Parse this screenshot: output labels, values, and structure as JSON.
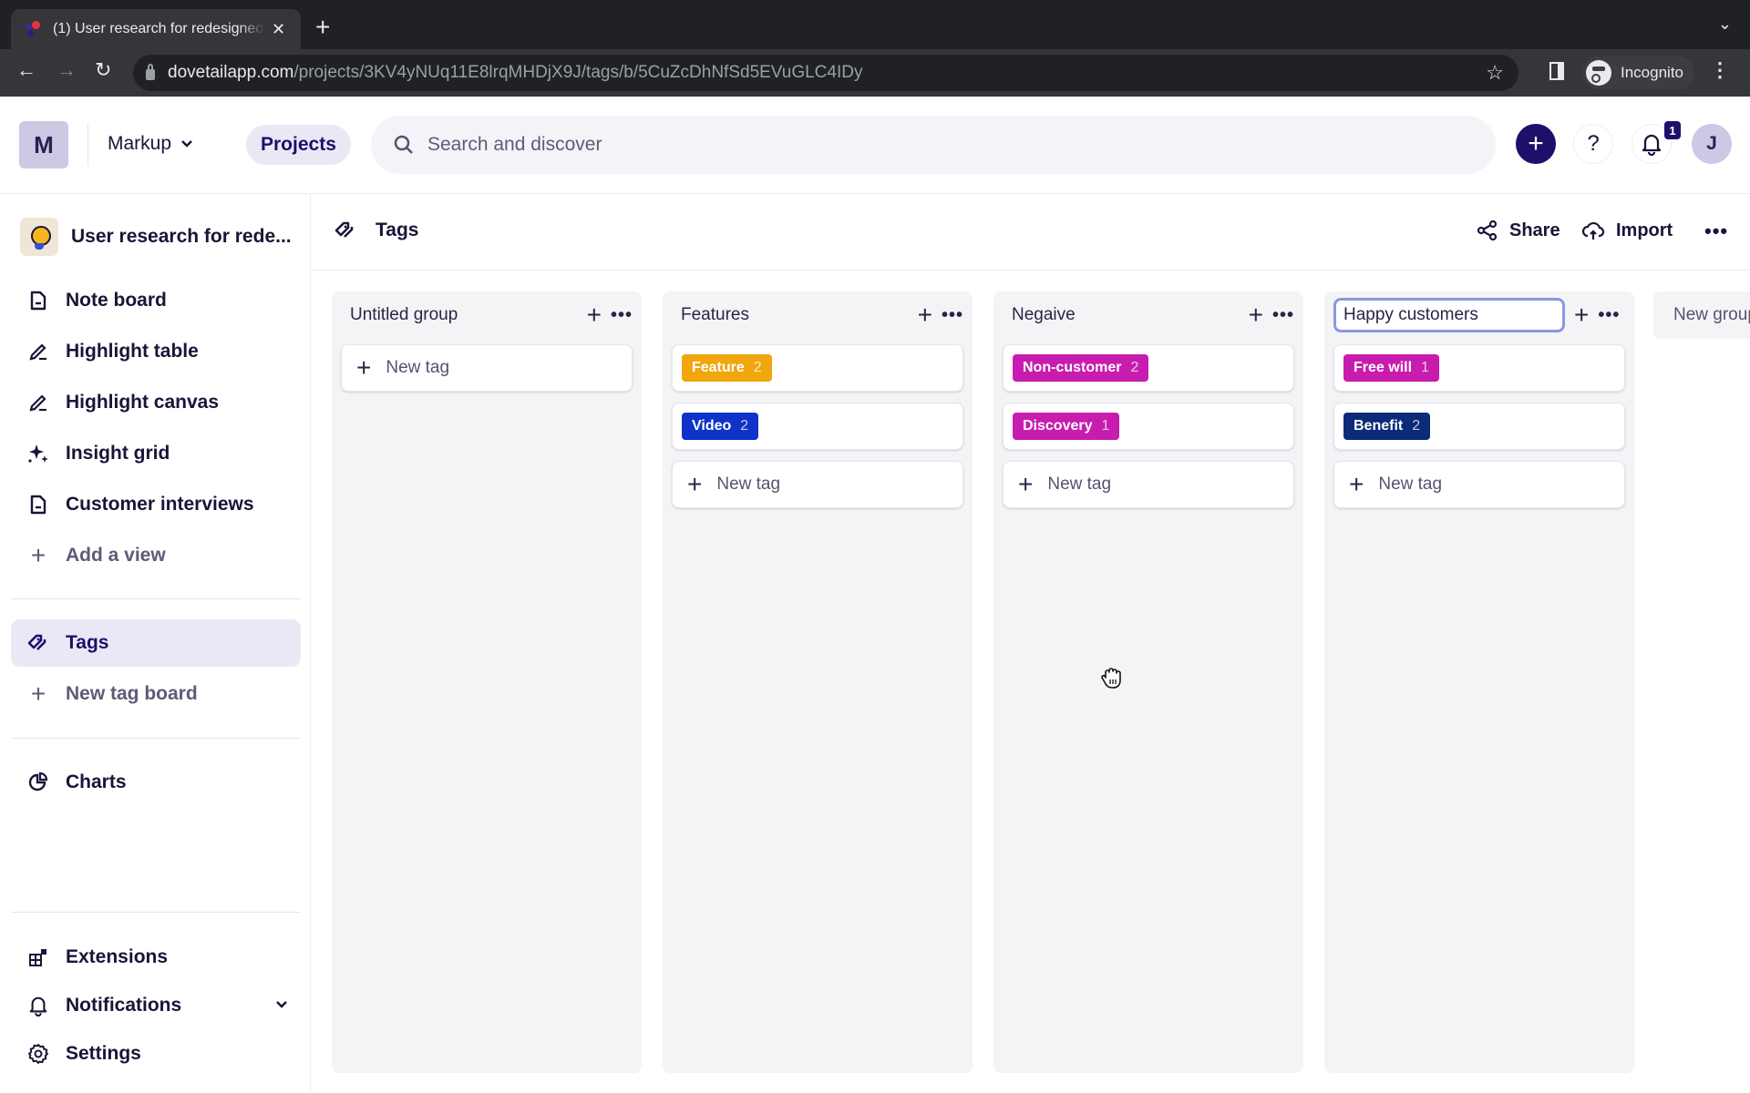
{
  "browser": {
    "tab_title": "(1) User research for redesigned",
    "new_tab": "+",
    "url_host": "dovetailapp.com",
    "url_path": "/projects/3KV4yNUq11E8lrqMHDjX9J/tags/b/5CuZcDhNfSd5EVuGLC4IDy",
    "incognito_label": "Incognito"
  },
  "header": {
    "workspace_initial": "M",
    "workspace_name": "Markup",
    "projects_label": "Projects",
    "search_placeholder": "Search and discover",
    "notification_count": "1",
    "avatar_initial": "J",
    "accent_color": "#1e0f6b"
  },
  "sidebar": {
    "project_name": "User research for rede...",
    "views": [
      {
        "label": "Note board",
        "icon": "note-icon"
      },
      {
        "label": "Highlight table",
        "icon": "highlight-icon"
      },
      {
        "label": "Highlight canvas",
        "icon": "highlight-icon"
      },
      {
        "label": "Insight grid",
        "icon": "sparkle-icon"
      },
      {
        "label": "Customer interviews",
        "icon": "note-icon"
      }
    ],
    "add_view": "Add a view",
    "tags": "Tags",
    "new_tag_board": "New tag board",
    "charts": "Charts",
    "extensions": "Extensions",
    "notifications": "Notifications",
    "settings": "Settings"
  },
  "main": {
    "title": "Tags",
    "share": "Share",
    "import": "Import",
    "new_group": "New group",
    "new_tag_label": "New tag",
    "groups": [
      {
        "name": "Untitled group",
        "editing": false,
        "tags": []
      },
      {
        "name": "Features",
        "editing": false,
        "tags": [
          {
            "label": "Feature",
            "count": "2",
            "color": "#f2a60d"
          },
          {
            "label": "Video",
            "count": "2",
            "color": "#0f33c9"
          }
        ]
      },
      {
        "name": "Negaive",
        "editing": false,
        "tags": [
          {
            "label": "Non-customer",
            "count": "2",
            "color": "#c81cae"
          },
          {
            "label": "Discovery",
            "count": "1",
            "color": "#c81cae"
          }
        ]
      },
      {
        "name": "Happy customers",
        "editing": true,
        "tags": [
          {
            "label": "Free will",
            "count": "1",
            "color": "#c81cae"
          },
          {
            "label": "Benefit",
            "count": "2",
            "color": "#0b2a78"
          }
        ]
      }
    ]
  }
}
